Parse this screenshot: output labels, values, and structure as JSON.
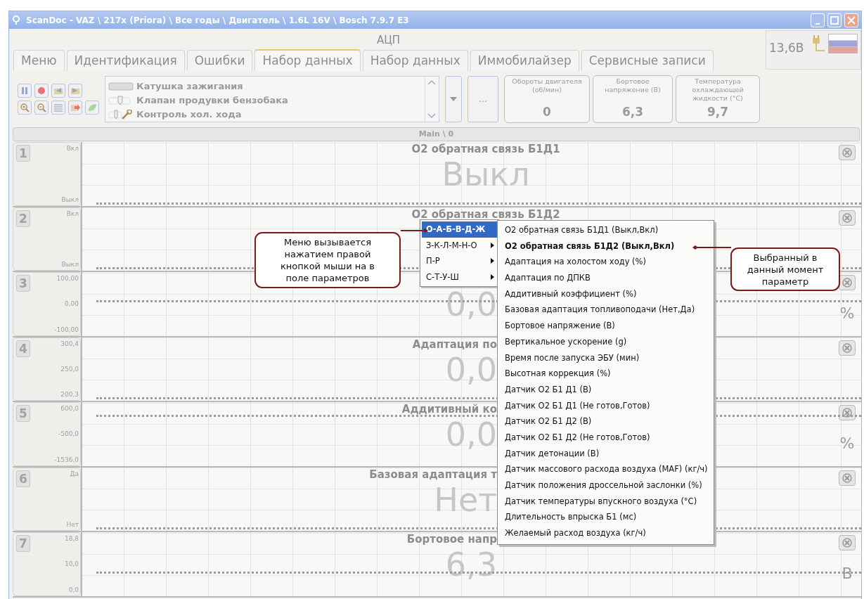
{
  "window": {
    "title": "ScanDoc - VAZ \\ 217x (Priora) \\ Все годы \\ Двигатель \\ 1.6L 16V \\ Bosch 7.9.7 E3"
  },
  "header": {
    "section": "АЦП",
    "voltage": "13,6В"
  },
  "tabs": [
    {
      "label": "Меню",
      "selected": false
    },
    {
      "label": "Идентификация",
      "selected": false
    },
    {
      "label": "Ошибки",
      "selected": false
    },
    {
      "label": "Набор данных",
      "selected": true
    },
    {
      "label": "Набор данных",
      "selected": false
    },
    {
      "label": "Иммобилайзер",
      "selected": false
    },
    {
      "label": "Сервисные записи",
      "selected": false
    }
  ],
  "actuators": [
    {
      "kind": "bar",
      "label": "Катушка зажигания"
    },
    {
      "kind": "valve",
      "label": "Клапан продувки бензобака"
    },
    {
      "kind": "wrench",
      "label": "Контроль хол. хода"
    }
  ],
  "more_button": "...",
  "gauges": [
    {
      "label": "Обороты двигателя (об/мин)",
      "value": "0"
    },
    {
      "label": "Бортовое напряжение (В)",
      "value": "6,3"
    },
    {
      "label": "Температура охлаждающей жидкости (°C)",
      "value": "9,7"
    }
  ],
  "main_bar": "Main \\ 0",
  "rows": [
    {
      "number": "1",
      "axis_labels": [
        "Вкл",
        "Выкл"
      ],
      "title": "O2 обратная связь Б1Д1",
      "value": "Выкл"
    },
    {
      "number": "2",
      "axis_labels": [
        "Вкл",
        "Выкл"
      ],
      "title": "O2 обратная связь Б1Д2"
    },
    {
      "number": "3",
      "axis_labels": [
        "100,00",
        "0,00",
        "-100,00"
      ],
      "value": "0,0",
      "unit": "%"
    },
    {
      "number": "4",
      "axis_labels": [
        "300,4",
        "250,0",
        "200,3"
      ],
      "title": "Адаптация по",
      "value": "0,0"
    },
    {
      "number": "5",
      "axis_labels": [
        "600,0",
        "-500,0",
        "-1536,0"
      ],
      "title": "Аддитивный ко",
      "value": "0,0",
      "unit": "%"
    },
    {
      "number": "6",
      "axis_labels": [
        "Да",
        "Нет"
      ],
      "title": "Базовая адаптация т",
      "value": "Нет"
    },
    {
      "number": "7",
      "axis_labels": [
        "18,8",
        "10,0",
        "0,0"
      ],
      "title": "Бортовое напр",
      "value": "6,3",
      "unit": "В"
    }
  ],
  "context_menu": {
    "groups": [
      {
        "label": "О-А-Б-В-Д-Ж",
        "selected": true
      },
      {
        "label": "З-К-Л-М-Н-О",
        "selected": false
      },
      {
        "label": "П-Р",
        "selected": false
      },
      {
        "label": "С-Т-У-Ш",
        "selected": false
      }
    ],
    "items": [
      {
        "label": "O2 обратная связь Б1Д1  (Выкл,Вкл)",
        "selected": false
      },
      {
        "label": "O2 обратная связь Б1Д2  (Выкл,Вкл)",
        "selected": true
      },
      {
        "label": "Адаптация на холостом ходу  (%)",
        "selected": false
      },
      {
        "label": "Адаптация по ДПКВ",
        "selected": false
      },
      {
        "label": "Аддитивный коэффициент  (%)",
        "selected": false
      },
      {
        "label": "Базовая адаптация топливоподачи  (Нет,Да)",
        "selected": false
      },
      {
        "label": "Бортовое напряжение  (В)",
        "selected": false
      },
      {
        "label": "Вертикальное ускорение  (g)",
        "selected": false
      },
      {
        "label": "Время после запуска ЭБУ  (мин)",
        "selected": false
      },
      {
        "label": "Высотная коррекция  (%)",
        "selected": false
      },
      {
        "label": "Датчик O2 Б1 Д1  (В)",
        "selected": false
      },
      {
        "label": "Датчик O2 Б1 Д1  (Не готов,Готов)",
        "selected": false
      },
      {
        "label": "Датчик O2 Б1 Д2  (В)",
        "selected": false
      },
      {
        "label": "Датчик O2 Б1 Д2  (Не готов,Готов)",
        "selected": false
      },
      {
        "label": "Датчик детонации  (В)",
        "selected": false
      },
      {
        "label": "Датчик массового расхода воздуха (MAF)  (кг/ч)",
        "selected": false
      },
      {
        "label": "Датчик положения дроссельной заслонки  (%)",
        "selected": false
      },
      {
        "label": "Датчик температуры впускного воздуха  (°C)",
        "selected": false
      },
      {
        "label": "Длительность впрыска Б1  (мс)",
        "selected": false
      },
      {
        "label": "Желаемый расход воздуха  (кг/ч)",
        "selected": false
      }
    ]
  },
  "callouts": [
    {
      "text": "Меню вызывается нажатием правой кнопкой мыши на в поле параметров"
    },
    {
      "text": "Выбранный в данный момент параметр"
    }
  ]
}
